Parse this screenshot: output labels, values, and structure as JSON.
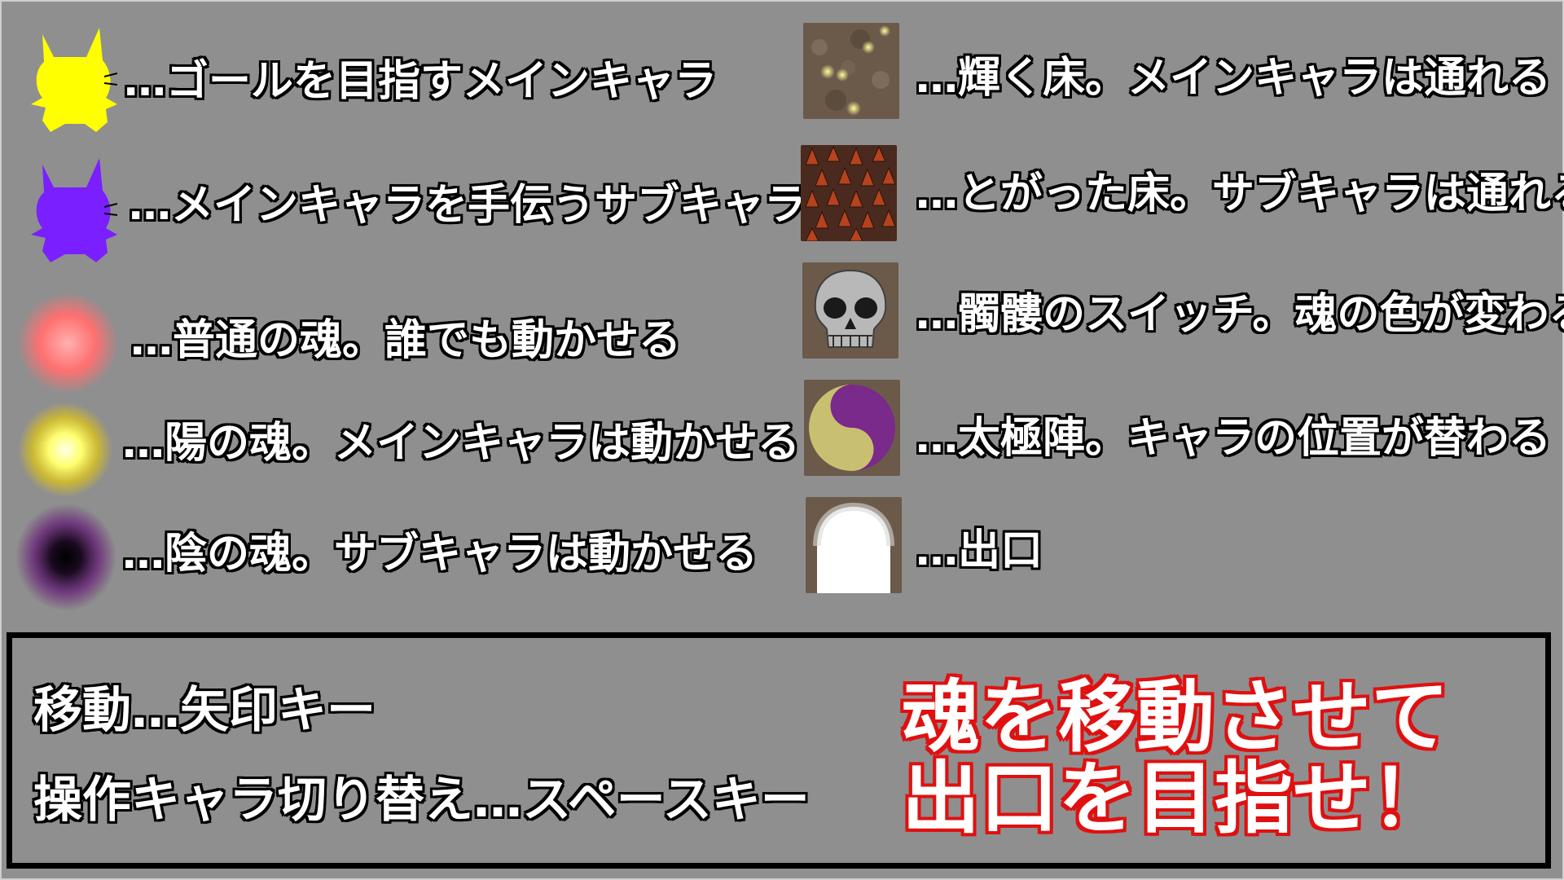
{
  "legend_left": [
    {
      "text": "…ゴールを目指すメインキャラ",
      "icon": "yellow-cat-icon",
      "color": "#ffff00"
    },
    {
      "text": "…メインキャラを手伝うサブキャラ",
      "icon": "purple-cat-icon",
      "color": "#7a1fff"
    },
    {
      "text": "…普通の魂。誰でも動かせる",
      "icon": "pink-soul-icon",
      "color": "#ff7f7f"
    },
    {
      "text": "…陽の魂。メインキャラは動かせる",
      "icon": "yellow-soul-icon",
      "color": "#ffff66"
    },
    {
      "text": "…陰の魂。サブキャラは動かせる",
      "icon": "dark-soul-icon",
      "color": "#6a2b7a"
    }
  ],
  "legend_right": [
    {
      "text": "…輝く床。メインキャラは通れる",
      "icon": "glowing-floor-icon"
    },
    {
      "text": "…とがった床。サブキャラは通れる",
      "icon": "spiked-floor-icon"
    },
    {
      "text": "…髑髏のスイッチ。魂の色が変わる",
      "icon": "skull-switch-icon"
    },
    {
      "text": "…太極陣。キャラの位置が替わる",
      "icon": "taiji-circle-icon"
    },
    {
      "text": "…出口",
      "icon": "exit-icon"
    }
  ],
  "controls": {
    "move": "移動…矢印キー",
    "switch": "操作キャラ切り替え…スペースキー"
  },
  "goal_message": {
    "line1": "魂を移動させて",
    "line2": "出口を目指せ！",
    "outline_color": "#e01010"
  }
}
